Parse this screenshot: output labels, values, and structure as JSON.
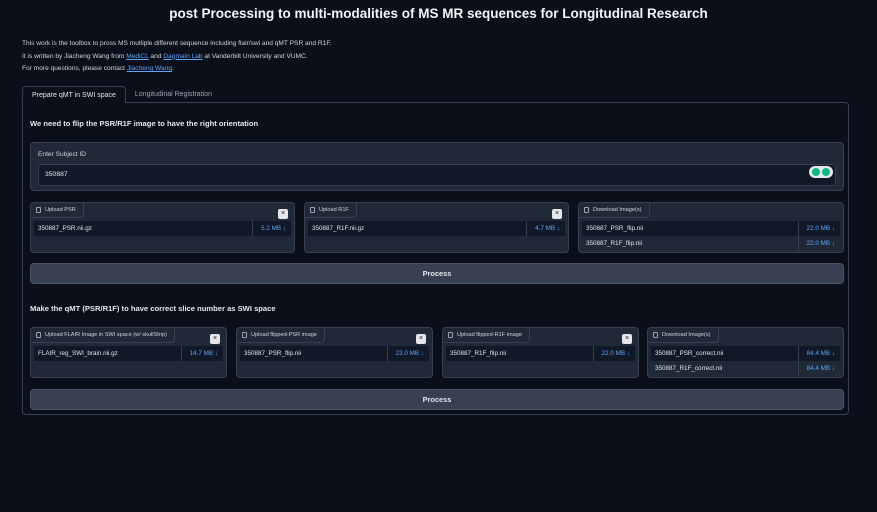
{
  "app": {
    "title": "post Processing to multi-modalities of MS MR sequences for Longitudinal Research"
  },
  "intro": {
    "line1": "This work is the toolbox to pross MS mutliple different sequence including flair/swi and qMT PSR and R1F.",
    "line2_prefix": "It is written by Jiacheng Wang from ",
    "link_medicl": "MediCL",
    "line2_and": " and ",
    "link_dagmain": "Dagmain Lab",
    "line2_suffix": " at Vanderbilt University and VUMC.",
    "line3_prefix": "For more questions, please contact ",
    "link_contact": "Jiacheng Wang",
    "line3_suffix": "."
  },
  "tabs": [
    {
      "label": "Prepare qMT in SWI space"
    },
    {
      "label": "Longitudinal Registration"
    }
  ],
  "section1": {
    "heading": "We need to flip the PSR/R1F image to have the right orientation",
    "subject_label": "Enter Subject ID",
    "subject_value": "350887",
    "upload_psr": {
      "label": "Upload PSR",
      "file": "350887_PSR.nii.gz",
      "size": "5.2 MB ↓"
    },
    "upload_r1f": {
      "label": "Upload R1F",
      "file": "350887_R1F.nii.gz",
      "size": "4.7 MB ↓"
    },
    "download": {
      "label": "Download Image(s)",
      "files": [
        {
          "name": "350887_PSR_flip.nii",
          "size": "22.0 MB ↓"
        },
        {
          "name": "350887_R1F_flip.nii",
          "size": "22.0 MB ↓"
        }
      ]
    },
    "process_label": "Process"
  },
  "section2": {
    "heading": "Make the qMT (PSR/R1F) to have correct slice number as SWI space",
    "upload_flair": {
      "label": "Upload FLAIR Image in SWI space (w/ skullStrip)",
      "file": "FLAIR_reg_SWI_brain.nii.gz",
      "size": "14.7 MB ↓"
    },
    "upload_psr": {
      "label": "Upload flipped-PSR image",
      "file": "350887_PSR_flip.nii",
      "size": "22.0 MB ↓"
    },
    "upload_r1f": {
      "label": "Upload flipped-R1F image",
      "file": "350887_R1F_flip.nii",
      "size": "22.0 MB ↓"
    },
    "download": {
      "label": "Download Image(s)",
      "files": [
        {
          "name": "350887_PSR_correct.nii",
          "size": "84.4 MB ↓"
        },
        {
          "name": "350887_R1F_correct.nii",
          "size": "84.4 MB ↓"
        }
      ]
    },
    "process_label": "Process"
  },
  "icons": {
    "close": "×"
  }
}
